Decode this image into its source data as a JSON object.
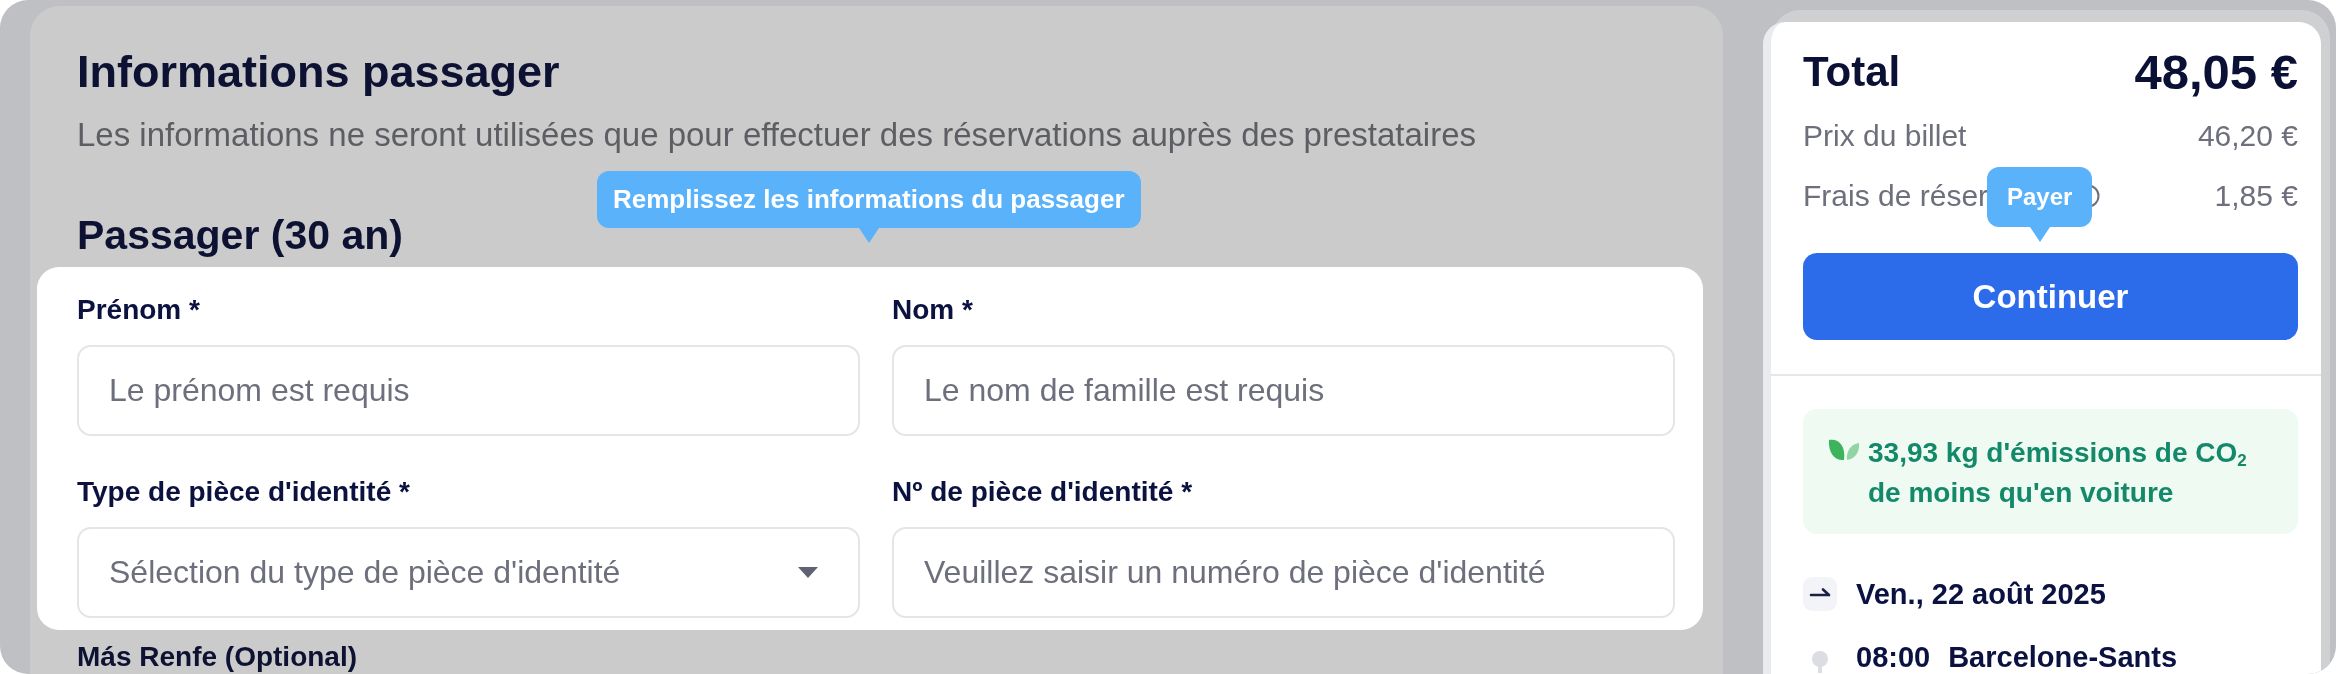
{
  "page": {
    "title": "Informations passager",
    "subtitle": "Les informations ne seront utilisées que pour effectuer des réservations auprès des prestataires"
  },
  "passenger": {
    "heading": "Passager (30 an)",
    "tooltip": "Remplissez les informations du passager",
    "fields": [
      {
        "kind": "text",
        "label": "Prénom *",
        "placeholder": "Le prénom est requis"
      },
      {
        "kind": "text",
        "label": "Nom *",
        "placeholder": "Le nom de famille est requis"
      },
      {
        "kind": "select",
        "label": "Type de pièce d'identité *",
        "placeholder": "Sélection du type de pièce d'identité"
      },
      {
        "kind": "text",
        "label": "Nº de pièce d'identité *",
        "placeholder": "Veuillez saisir un numéro de pièce d'identité"
      }
    ]
  },
  "loyalty": {
    "heading": "Más Renfe (Optional)"
  },
  "summary": {
    "total_label": "Total",
    "total_value": "48,05 €",
    "lines": [
      {
        "label": "Prix du billet",
        "value": "46,20 €",
        "info_icon": false
      },
      {
        "label": "Frais de réser",
        "value": "1,85 €",
        "info_icon": true
      }
    ],
    "tooltip": "Payer",
    "button": "Continuer",
    "co2_note": {
      "lines": [
        "33,93 kg d'émissions de CO$_{2}$",
        "de moins qu'en voiture"
      ]
    },
    "trip": {
      "date": "Ven., 22 août 2025",
      "stops": [
        {
          "time": "08:00",
          "station": "Barcelone-Sants"
        }
      ]
    }
  }
}
